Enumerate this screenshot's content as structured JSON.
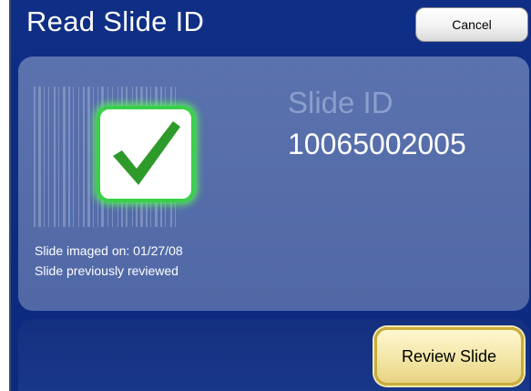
{
  "window": {
    "title": "Read Slide ID"
  },
  "toolbar": {
    "cancel_label": "Cancel"
  },
  "slide": {
    "id_label": "Slide ID",
    "id_value": "10065002005",
    "imaged_text": "Slide imaged on: 01/27/08",
    "review_status": "Slide previously reviewed"
  },
  "actions": {
    "review_label": "Review Slide"
  },
  "icons": {
    "barcode": "barcode-icon",
    "check": "checkmark-icon"
  },
  "colors": {
    "background": "#0f2e86",
    "panel": "#5a72ad",
    "check_green": "#2e9a2a",
    "check_border": "#39d04a",
    "review_button": "#f3e6a6"
  }
}
